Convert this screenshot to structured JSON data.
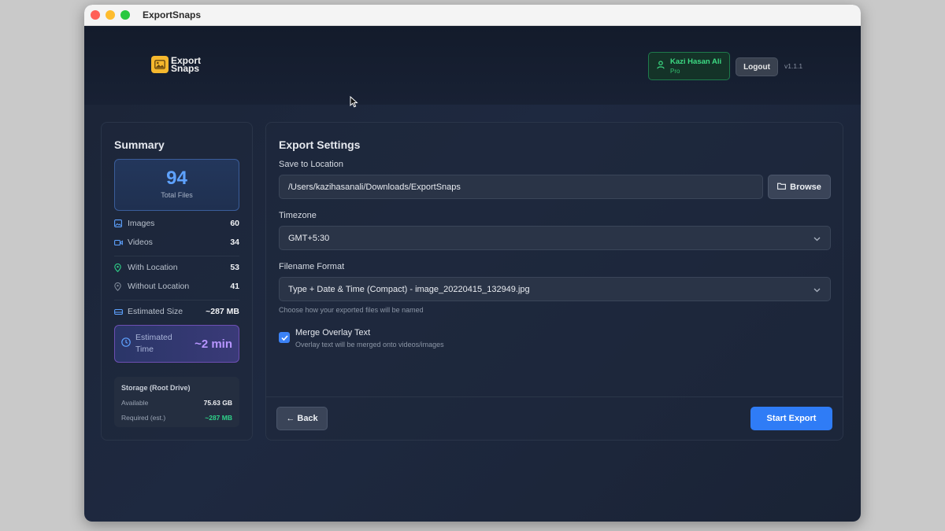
{
  "window": {
    "title": "ExportSnaps"
  },
  "header": {
    "logo_line1": "Export",
    "logo_line2": "Snaps",
    "user_name": "Kazi Hasan Ali",
    "user_plan": "Pro",
    "logout_label": "Logout",
    "version": "v1.1.1"
  },
  "summary": {
    "title": "Summary",
    "total_value": "94",
    "total_label": "Total Files",
    "images_label": "Images",
    "images_value": "60",
    "videos_label": "Videos",
    "videos_value": "34",
    "with_location_label": "With Location",
    "with_location_value": "53",
    "without_location_label": "Without Location",
    "without_location_value": "41",
    "size_label": "Estimated Size",
    "size_value": "~287 MB",
    "time_label_line1": "Estimated",
    "time_label_line2": "Time",
    "time_value": "~2 min",
    "storage": {
      "title": "Storage (Root Drive)",
      "available_label": "Available",
      "available_value": "75.63 GB",
      "required_label": "Required (est.)",
      "required_value": "~287 MB"
    }
  },
  "settings": {
    "title": "Export Settings",
    "save_label": "Save to Location",
    "save_path": "/Users/kazihasanali/Downloads/ExportSnaps",
    "browse_label": "Browse",
    "timezone_label": "Timezone",
    "timezone_value": "GMT+5:30",
    "filename_label": "Filename Format",
    "filename_value": "Type + Date & Time (Compact) - image_20220415_132949.jpg",
    "filename_hint": "Choose how your exported files will be named",
    "merge_label": "Merge Overlay Text",
    "merge_desc": "Overlay text will be merged onto videos/images",
    "merge_checked": true,
    "back_label": "← Back",
    "start_label": "Start Export"
  },
  "colors": {
    "accent": "#2f7cf6",
    "success": "#3ddc84",
    "purple": "#b795ff",
    "total_blue": "#5ea2ff"
  }
}
